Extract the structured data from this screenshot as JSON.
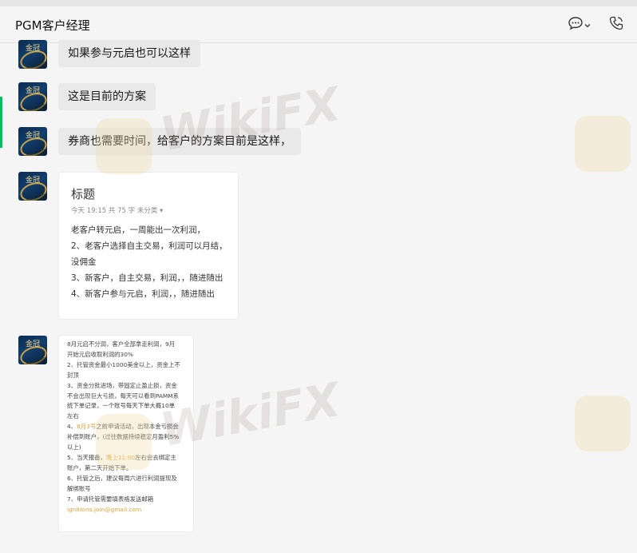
{
  "header": {
    "title": "PGM客户经理"
  },
  "avatar_text": "金冠",
  "messages": [
    {
      "text": "如果参与元启也可以这样"
    },
    {
      "text": "这是目前的方案"
    },
    {
      "text": "券商也需要时间，给客户的方案目前是这样，"
    }
  ],
  "note": {
    "title": "标题",
    "meta": "今天 19:15  共 75 字   未分类 ▾",
    "lines": [
      "老客户转元启，一周能出一次利润，",
      "2、老客户选择自主交易，利润可以月结，",
      "没佣金",
      "3、新客户，自主交易，利润，，随进随出",
      "4、新客户参与元启，利润，，随进随出"
    ]
  },
  "image_card": {
    "lines": [
      "8月元启不分润，客户全部拿走利润，9月",
      "开始元启收取利润的30%",
      "2、托管资金最小1000美金以上，资金上不",
      "封顶",
      "3、资金分批进场，带固定止盈止损，资金",
      "不会出现巨大亏损，每天可以看到PAMM系",
      "统下单记录，一个账号每天下单大概10单",
      "左右",
      "4、|8月3号|之前申请活动，出现本金亏损会",
      "补偿到账户，(过往数据持续稳定月盈利5%",
      "以上)",
      "5、当天报备，|晚上11:00|左右会去绑定主",
      "账户，第二天开始下单。",
      "6、托管之后，建议每周六进行利润提现及",
      "解绑账号",
      "7、申请托管需要填表格发送邮箱",
      "|ignitions.join@gmail.com|"
    ]
  },
  "watermark": {
    "text": "WikiFX"
  },
  "colors": {
    "accent": "#07c160",
    "bubble": "#e9e9e9",
    "highlight": "#e6a23c"
  }
}
